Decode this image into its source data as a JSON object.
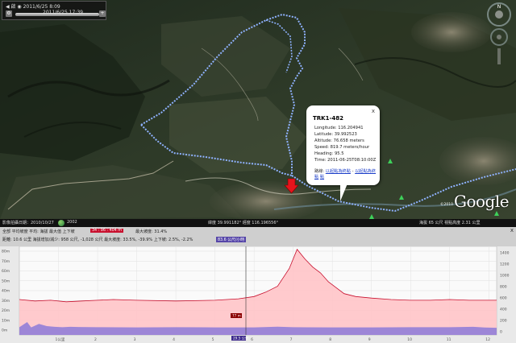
{
  "time_slider": {
    "label": "◀ 啟 ◉ 2011/6/25  8:09",
    "end": "2011/6/25  17:39"
  },
  "balloon": {
    "title": "TRK1-482",
    "close": "x",
    "lines": [
      "Longitude: 116.204941",
      "Latitude: 39.992523",
      "Altitude: 76.658 meters",
      "Speed: 819.7 meters/hour",
      "Heading: 95.5",
      "Time: 2011-06-25T08:10:00Z"
    ],
    "links_prefix": "路線:",
    "link1": "以起點為終點",
    "link2": "以起點為終點",
    "link_suffix": "點"
  },
  "google": {
    "logo": "Google",
    "copyright": "©2010"
  },
  "status_bar": {
    "date_label": "影像拍攝日期：2010/10/27",
    "year": "2002",
    "coords": "緯度 39.991182° 經度 116.196556°",
    "elev": "海拔 65 公尺  視點高度 2.31 公里"
  },
  "profile_header": {
    "row1": "全部  平均坡度  平均: 海拔  最大值  上下坡",
    "elev_tag": "34 : 96 : 404 m",
    "row1b": "最大坡度: 31.4%",
    "row2": "距離: 10.6 公里  海拔增加/減少: 958 公尺, -1,028 公尺  最大坡度: 33.5%, -39.9%  上下坡: 2.5%, -2.2%",
    "speed_tag": "83.6 公尺/小時",
    "close": "x"
  },
  "chart_data": {
    "type": "area",
    "title": "",
    "xlabel": "",
    "ylabel": "",
    "x_ticks": [
      "1公里",
      "2",
      "3",
      "4",
      "5",
      "6",
      "7",
      "8",
      "9",
      "10",
      "11",
      "12"
    ],
    "left_ticks": [
      "80m",
      "70m",
      "60m",
      "50m",
      "40m",
      "30m",
      "20m",
      "10m",
      "0m"
    ],
    "right_ticks": [
      "1400",
      "1200",
      "1000",
      "800",
      "600",
      "400",
      "200",
      "0"
    ],
    "markers": {
      "cursor_value": "77 m",
      "cursor_x": "29.5 公里"
    },
    "elevation": [
      [
        0,
        48
      ],
      [
        0.4,
        46
      ],
      [
        0.8,
        47
      ],
      [
        1.2,
        45
      ],
      [
        1.6,
        46
      ],
      [
        2,
        47
      ],
      [
        2.4,
        48
      ],
      [
        3,
        47
      ],
      [
        4,
        46
      ],
      [
        5,
        47
      ],
      [
        5.6,
        49
      ],
      [
        6,
        52
      ],
      [
        6.3,
        58
      ],
      [
        6.6,
        66
      ],
      [
        6.9,
        90
      ],
      [
        7.1,
        116
      ],
      [
        7.3,
        103
      ],
      [
        7.5,
        92
      ],
      [
        7.7,
        84
      ],
      [
        7.9,
        72
      ],
      [
        8.1,
        64
      ],
      [
        8.3,
        56
      ],
      [
        8.6,
        52
      ],
      [
        9,
        50
      ],
      [
        9.5,
        48
      ],
      [
        10,
        47
      ],
      [
        10.5,
        47
      ],
      [
        11,
        48
      ],
      [
        11.5,
        47
      ],
      [
        12.2,
        47
      ]
    ],
    "speed": [
      [
        0,
        42
      ],
      [
        0.2,
        70
      ],
      [
        0.3,
        41
      ],
      [
        0.5,
        60
      ],
      [
        0.7,
        48
      ],
      [
        0.9,
        44
      ],
      [
        1.1,
        42
      ],
      [
        1.3,
        44
      ],
      [
        1.5,
        43
      ],
      [
        2,
        42
      ],
      [
        3,
        41
      ],
      [
        4,
        42
      ],
      [
        5,
        41
      ],
      [
        6,
        41
      ],
      [
        6.6,
        45
      ],
      [
        7,
        42
      ],
      [
        8,
        41
      ],
      [
        9,
        41
      ],
      [
        10,
        42
      ],
      [
        11,
        42
      ],
      [
        11.6,
        44
      ],
      [
        11.9,
        40
      ],
      [
        12.2,
        39
      ]
    ]
  },
  "colors": {
    "route": "#7fa7ff",
    "profile_fill": "#ffc4c8",
    "profile_line": "#c8102e",
    "speed_fill": "#8c7ad8"
  }
}
